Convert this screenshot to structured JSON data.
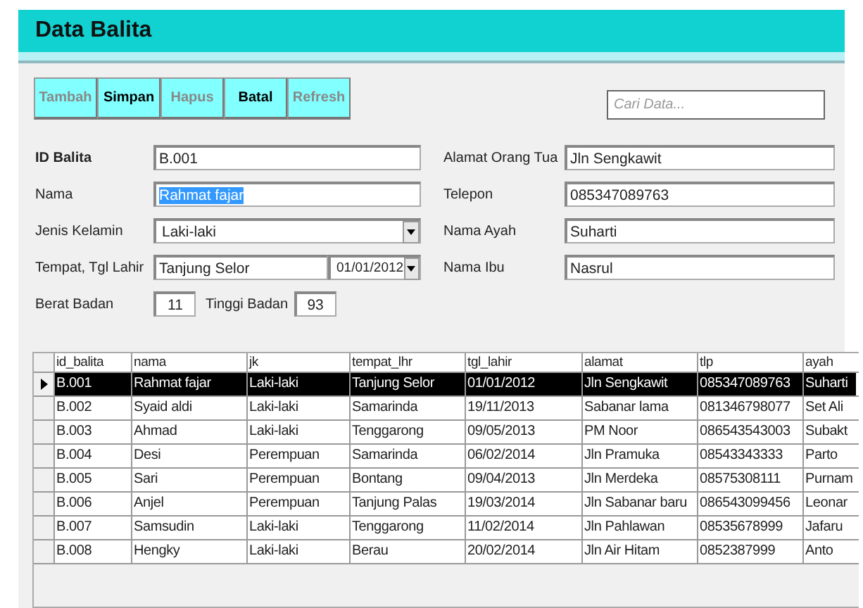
{
  "window": {
    "title": "Data Balita"
  },
  "buttons": [
    {
      "label": "Tambah",
      "disabled": true
    },
    {
      "label": "Simpan",
      "disabled": false
    },
    {
      "label": "Hapus",
      "disabled": true
    },
    {
      "label": "Batal",
      "disabled": false
    },
    {
      "label": "Refresh",
      "disabled": true
    }
  ],
  "search": {
    "placeholder": "Cari Data..."
  },
  "form_left": [
    {
      "label": "ID Balita",
      "kind": "text",
      "value": "B.001",
      "bold": true
    },
    {
      "label": "Nama",
      "kind": "text",
      "value": "Rahmat fajar",
      "bold": false,
      "highlighted": true
    },
    {
      "label": "Jenis Kelamin",
      "kind": "dropdown",
      "value": "Laki-laki",
      "bold": false
    },
    {
      "label": "Tempat, Tgl Lahir",
      "kind": "place_date",
      "value": "Tanjung Selor",
      "date": "01/01/2012",
      "bold": false
    }
  ],
  "measures": {
    "berat_label": "Berat Badan",
    "berat": "11",
    "tinggi_label": "Tinggi Badan",
    "tinggi": "93"
  },
  "form_right": [
    {
      "label": "Alamat Orang Tua",
      "value": "Jln Sengkawit"
    },
    {
      "label": "Telepon",
      "value": "085347089763"
    },
    {
      "label": "Nama Ayah",
      "value": "Suharti"
    },
    {
      "label": "Nama Ibu",
      "value": "Nasrul"
    }
  ],
  "table": {
    "columns": [
      "id_balita",
      "nama",
      "jk",
      "tempat_lhr",
      "tgl_lahir",
      "alamat",
      "tlp",
      "ayah"
    ],
    "rows": [
      {
        "selected": true,
        "cells": [
          "B.001",
          "Rahmat fajar",
          "Laki-laki",
          "Tanjung Selor",
          "01/01/2012",
          "Jln Sengkawit",
          "085347089763",
          "Suharti"
        ]
      },
      {
        "selected": false,
        "cells": [
          "B.002",
          "Syaid aldi",
          "Laki-laki",
          "Samarinda",
          "19/11/2013",
          "Sabanar lama",
          "081346798077",
          "Set Ali"
        ]
      },
      {
        "selected": false,
        "cells": [
          "B.003",
          "Ahmad",
          "Laki-laki",
          "Tenggarong",
          "09/05/2013",
          "PM Noor",
          "086543543003",
          "Subakt"
        ]
      },
      {
        "selected": false,
        "cells": [
          "B.004",
          "Desi",
          "Perempuan",
          "Samarinda",
          "06/02/2014",
          "Jln Pramuka",
          "08543343333",
          "Parto"
        ]
      },
      {
        "selected": false,
        "cells": [
          "B.005",
          "Sari",
          "Perempuan",
          "Bontang",
          "09/04/2013",
          "Jln Merdeka",
          "08575308111",
          "Purnam"
        ]
      },
      {
        "selected": false,
        "cells": [
          "B.006",
          "Anjel",
          "Perempuan",
          "Tanjung Palas",
          "19/03/2014",
          "Jln Sabanar baru",
          "086543099456",
          "Leonar"
        ]
      },
      {
        "selected": false,
        "cells": [
          "B.007",
          "Samsudin",
          "Laki-laki",
          "Tenggarong",
          "11/02/2014",
          "Jln Pahlawan",
          "08535678999",
          "Jafaru"
        ]
      },
      {
        "selected": false,
        "cells": [
          "B.008",
          "Hengky",
          "Laki-laki",
          "Berau",
          "20/02/2014",
          "Jln Air Hitam",
          "0852387999",
          "Anto"
        ]
      }
    ]
  }
}
